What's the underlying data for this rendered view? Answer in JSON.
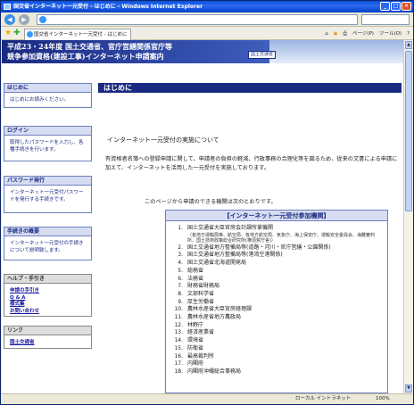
{
  "window": {
    "title": "国交省インターネット一元受付 - はじめに - Windows Internet Explorer",
    "address": "",
    "tab_title": "国交省インターネット一元受付 - はじめに",
    "status": {
      "zone": "ローカル イントラネット",
      "zoom": "100%"
    },
    "toolbar": {
      "page": "ページ(P)",
      "tools": "ツール(O)"
    },
    "controls": {
      "back": "◀",
      "forward": "▶",
      "minimize": "_",
      "maximize": "□",
      "close": "×"
    }
  },
  "header": {
    "line1": "平成23・24年度 国土交通省、官庁営繕関係官庁等",
    "line2": "競争参加資格(建設工事)インターネット申請案内",
    "badge": "国土交通省"
  },
  "sidebar": [
    {
      "title": "はじめに",
      "body": "はじめにお読みください。"
    },
    {
      "title": "ログイン",
      "body": "取得したパスワードを入力し、各種手続きを行います。"
    },
    {
      "title": "パスワード発行",
      "body": "インターネット一元受付パスワードを発行する手続きです。"
    },
    {
      "title": "手続きの概要",
      "body": "インターネット一元受付の手続きについて説明致します。"
    }
  ],
  "help": {
    "title": "ヘルプ・手引き",
    "links": [
      "申請の手引き",
      "Q & A",
      "様式集",
      "お問い合わせ"
    ]
  },
  "link": {
    "title": "リンク",
    "links": [
      "国土交通省"
    ]
  },
  "main": {
    "title": "はじめに",
    "subtitle": "インターネット一元受付の実施について",
    "paragraph": "有資格者名簿への登録申請に関して、申請者の負担の軽減、行政事務の合理化等を図るため、従来の文書による申請に加えて、インターネットを活用した一元受付を実施しております。",
    "available": "このページから申請のできる機関は次のとおりです。",
    "box_title": "【インターネット一元受付参加機関】",
    "agencies": [
      {
        "num": "1.",
        "name": "国土交通省大臣官房会計課所掌機関",
        "note": "（各地方運輸局等、航空局、各地方航空局、気象庁、海上保安庁、運輸安全委員会、海難審判所、国土技術政策総合研究所(横須賀庁舎)）"
      },
      {
        "num": "2.",
        "name": "国土交通省地方整備局等(道路・河川・官庁営繕・公園関係)",
        "note": ""
      },
      {
        "num": "3.",
        "name": "国土交通省地方整備局等(港湾空港関係)",
        "note": ""
      },
      {
        "num": "4.",
        "name": "国土交通省北海道開発局",
        "note": ""
      },
      {
        "num": "5.",
        "name": "総務省",
        "note": ""
      },
      {
        "num": "6.",
        "name": "法務省",
        "note": ""
      },
      {
        "num": "7.",
        "name": "財務省財務局",
        "note": ""
      },
      {
        "num": "8.",
        "name": "文部科学省",
        "note": ""
      },
      {
        "num": "9.",
        "name": "厚生労働省",
        "note": ""
      },
      {
        "num": "10.",
        "name": "農林水産省大臣官房経理課",
        "note": ""
      },
      {
        "num": "11.",
        "name": "農林水産省地方農政局",
        "note": ""
      },
      {
        "num": "12.",
        "name": "林野庁",
        "note": ""
      },
      {
        "num": "13.",
        "name": "経済産業省",
        "note": ""
      },
      {
        "num": "14.",
        "name": "環境省",
        "note": ""
      },
      {
        "num": "15.",
        "name": "防衛省",
        "note": ""
      },
      {
        "num": "16.",
        "name": "最高裁判所",
        "note": ""
      },
      {
        "num": "17.",
        "name": "内閣府",
        "note": ""
      },
      {
        "num": "18.",
        "name": "内閣府沖縄総合事務局",
        "note": ""
      }
    ]
  }
}
